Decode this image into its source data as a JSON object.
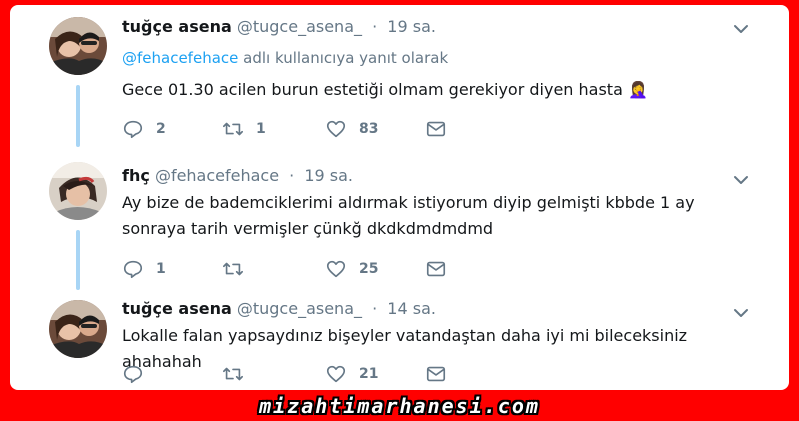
{
  "colors": {
    "frame": "#ff0000",
    "card": "#ffffff",
    "text": "#14171a",
    "muted": "#657786",
    "link": "#1da1f2",
    "thread_line": "#a8d5f5"
  },
  "tweets": [
    {
      "display_name": "tuğçe asena",
      "handle": "@tugce_asena_",
      "separator": "·",
      "time": "19 sa.",
      "reply_mention": "@fehacefehace",
      "reply_suffix": "adlı kullanıcıya yanıt olarak",
      "text": "Gece 01.30 acilen burun estetiği olmam gerekiyor diyen hasta 🤦‍♀️",
      "replies": "2",
      "retweets": "1",
      "likes": "83"
    },
    {
      "display_name": "fhç",
      "handle": "@fehacefehace",
      "separator": "·",
      "time": "19 sa.",
      "text": "Ay bize de bademciklerimi aldırmak istiyorum diyip gelmişti kbbde 1 ay sonraya tarih vermişler çünkğ dkdkdmdmdmd",
      "replies": "1",
      "retweets": "",
      "likes": "25"
    },
    {
      "display_name": "tuğçe asena",
      "handle": "@tugce_asena_",
      "separator": "·",
      "time": "14 sa.",
      "text": "Lokalle falan yapsaydınız bişeyler vatandaştan daha iyi mi bileceksiniz ahahahah",
      "replies": "",
      "retweets": "",
      "likes": "21"
    }
  ],
  "icons": {
    "reply": "reply-icon",
    "retweet": "retweet-icon",
    "like": "heart-icon",
    "message": "envelope-icon",
    "menu": "chevron-down-icon"
  },
  "watermark": "mizahtimarhanesi.com"
}
